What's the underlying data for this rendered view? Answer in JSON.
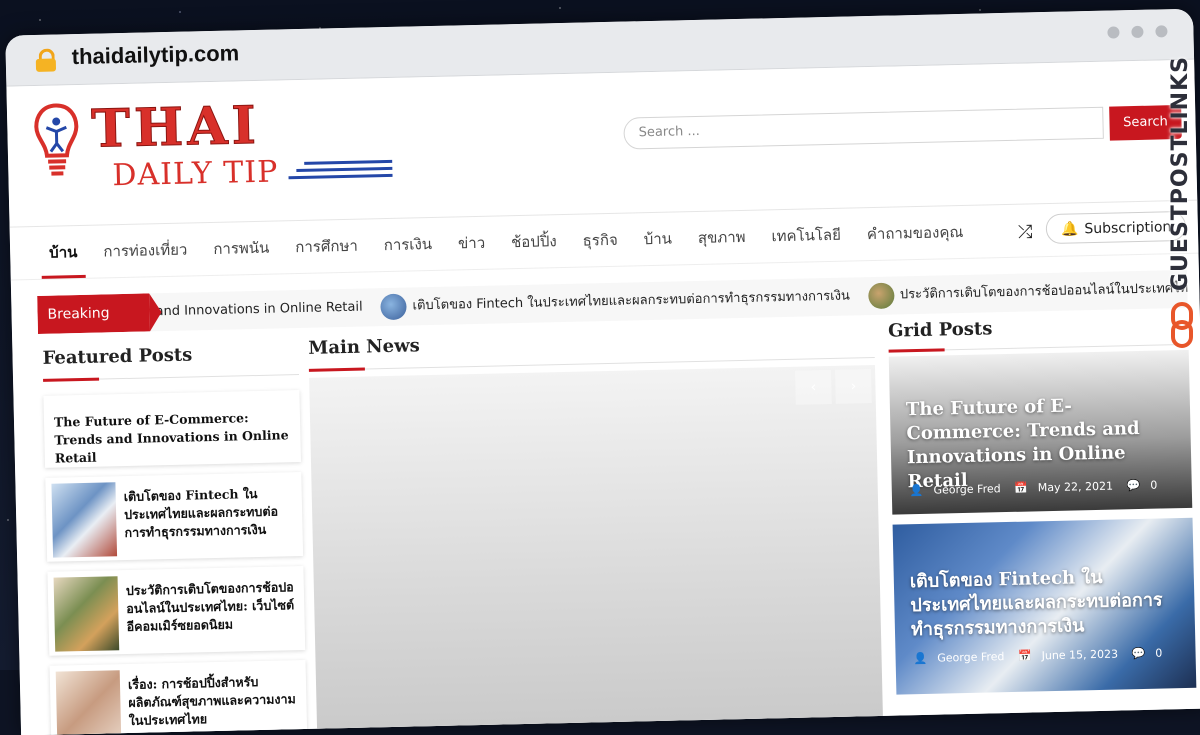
{
  "browser": {
    "url": "thaidailytip.com"
  },
  "site": {
    "logo_main": "THAI",
    "logo_sub": "DAILY TIP",
    "search_placeholder": "Search ...",
    "search_button": "Search"
  },
  "nav": {
    "items": [
      "บ้าน",
      "การท่องเที่ยว",
      "การพนัน",
      "การศึกษา",
      "การเงิน",
      "ข่าว",
      "ช้อปปิ้ง",
      "ธุรกิจ",
      "บ้าน",
      "สุขภาพ",
      "เทคโนโลยี",
      "คำถามของคุณ"
    ],
    "active_index": 0,
    "subscription": "Subscription"
  },
  "ticker": {
    "label": "Breaking News",
    "items": [
      "and Innovations in Online Retail",
      "เติบโตของ Fintech ในประเทศไทยและผลกระทบต่อการทำธุรกรรมทางการเงิน",
      "ประวัติการเติบโตของการช้อปออนไลน์ในประเทศไทย:"
    ]
  },
  "featured": {
    "title": "Featured Posts",
    "posts": [
      "The Future of E-Commerce: Trends and Innovations in Online Retail",
      "เติบโตของ Fintech ในประเทศไทยและผลกระทบต่อการทำธุรกรรมทางการเงิน",
      "ประวัติการเติบโตของการช้อปออนไลน์ในประเทศไทย: เว็บไซต์อีคอมเมิร์ซยอดนิยม",
      "เรื่อง: การช้อปปิ้งสำหรับผลิตภัณฑ์สุขภาพและความงามในประเทศไทย"
    ]
  },
  "main_news": {
    "title": "Main News"
  },
  "grid": {
    "title": "Grid Posts",
    "posts": [
      {
        "title": "The Future of E-Commerce: Trends and Innovations in Online Retail",
        "author": "George Fred",
        "date": "May 22, 2021",
        "comments": "0"
      },
      {
        "title": "เติบโตของ Fintech ในประเทศไทยและผลกระทบต่อการทำธุรกรรมทางการเงิน",
        "author": "George Fred",
        "date": "June 15, 2023",
        "comments": "0"
      }
    ]
  },
  "watermark": {
    "text": "GUESTPOSTLINKS"
  },
  "colors": {
    "accent": "#c8171f",
    "logo_blue": "#2447a8"
  }
}
